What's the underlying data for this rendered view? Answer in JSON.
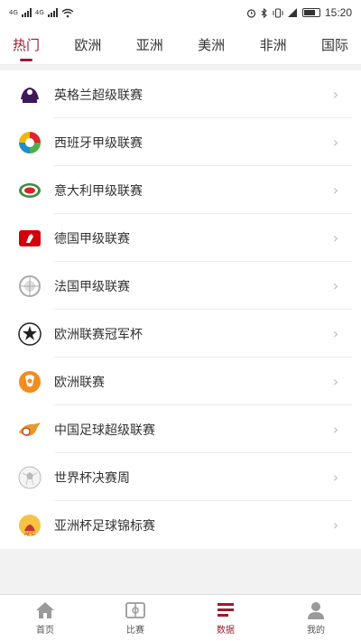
{
  "status": {
    "carrier1": "4G",
    "carrier2": "4G",
    "battery_label": "",
    "time": "15:20"
  },
  "tabs": [
    {
      "label": "热门",
      "active": true
    },
    {
      "label": "欧洲",
      "active": false
    },
    {
      "label": "亚洲",
      "active": false
    },
    {
      "label": "美洲",
      "active": false
    },
    {
      "label": "非洲",
      "active": false
    },
    {
      "label": "国际",
      "active": false
    }
  ],
  "leagues": [
    {
      "label": "英格兰超级联赛",
      "icon": "premier-league-logo"
    },
    {
      "label": "西班牙甲级联赛",
      "icon": "laliga-logo"
    },
    {
      "label": "意大利甲级联赛",
      "icon": "serie-a-logo"
    },
    {
      "label": "德国甲级联赛",
      "icon": "bundesliga-logo"
    },
    {
      "label": "法国甲级联赛",
      "icon": "ligue1-logo"
    },
    {
      "label": "欧洲联赛冠军杯",
      "icon": "champions-league-logo"
    },
    {
      "label": "欧洲联赛",
      "icon": "europa-league-logo"
    },
    {
      "label": "中国足球超级联赛",
      "icon": "csl-logo"
    },
    {
      "label": "世界杯决赛周",
      "icon": "world-cup-logo"
    },
    {
      "label": "亚洲杯足球锦标赛",
      "icon": "afc-asian-cup-logo"
    }
  ],
  "bottom_nav": [
    {
      "label": "首页",
      "icon": "home-icon",
      "active": false
    },
    {
      "label": "比赛",
      "icon": "match-icon",
      "active": false
    },
    {
      "label": "数据",
      "icon": "data-icon",
      "active": true
    },
    {
      "label": "我的",
      "icon": "profile-icon",
      "active": false
    }
  ],
  "colors": {
    "accent": "#9b1c31",
    "background": "#f2f2f2"
  }
}
